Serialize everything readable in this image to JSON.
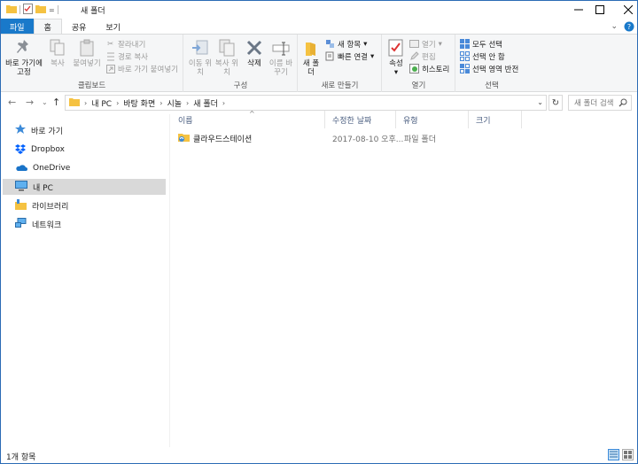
{
  "window": {
    "title": "새 폴더",
    "qat_separator": "|",
    "qat_dropdown": "="
  },
  "tabs": [
    "파일",
    "홈",
    "공유",
    "보기"
  ],
  "ribbon": {
    "clipboard": {
      "label": "클립보드",
      "pin": "바로 가기에 고정",
      "copy": "복사",
      "paste": "붙여넣기",
      "cut": "잘라내기",
      "copy_path": "경로 복사",
      "paste_shortcut": "바로 가기 붙여넣기"
    },
    "organize": {
      "label": "구성",
      "move": "이동 위치",
      "copy_to": "복사 위치",
      "delete": "삭제",
      "rename": "이름 바꾸기"
    },
    "new": {
      "label": "새로 만들기",
      "new_folder": "새 폴더",
      "new_item": "새 항목",
      "easy_access": "빠른 연결"
    },
    "open": {
      "label": "열기",
      "properties": "속성",
      "open": "열기",
      "edit": "편집",
      "history": "히스토리"
    },
    "select": {
      "label": "선택",
      "select_all": "모두 선택",
      "select_none": "선택 안 함",
      "invert": "선택 영역 반전"
    }
  },
  "address": {
    "crumbs": [
      "내 PC",
      "바탕 화면",
      "시놀",
      "새 폴더"
    ],
    "search_placeholder": "새 폴더 검색"
  },
  "nav_pane": {
    "items": [
      {
        "label": "바로 가기",
        "icon": "star-icon"
      },
      {
        "label": "Dropbox",
        "icon": "dropbox-icon"
      },
      {
        "label": "OneDrive",
        "icon": "cloud-icon"
      },
      {
        "label": "내 PC",
        "icon": "computer-icon"
      },
      {
        "label": "라이브러리",
        "icon": "library-icon"
      },
      {
        "label": "네트워크",
        "icon": "network-icon"
      }
    ]
  },
  "columns": [
    "이름",
    "수정한 날짜",
    "유형",
    "크기"
  ],
  "files": [
    {
      "name": "클라우드스테이션",
      "modified": "2017-08-10 오후...",
      "type": "파일 폴더",
      "size": ""
    }
  ],
  "status": {
    "count": "1개 항목"
  },
  "colors": {
    "file_tab": "#1979ca",
    "selection": "#d9d9d9",
    "folder": "#f5c242"
  }
}
